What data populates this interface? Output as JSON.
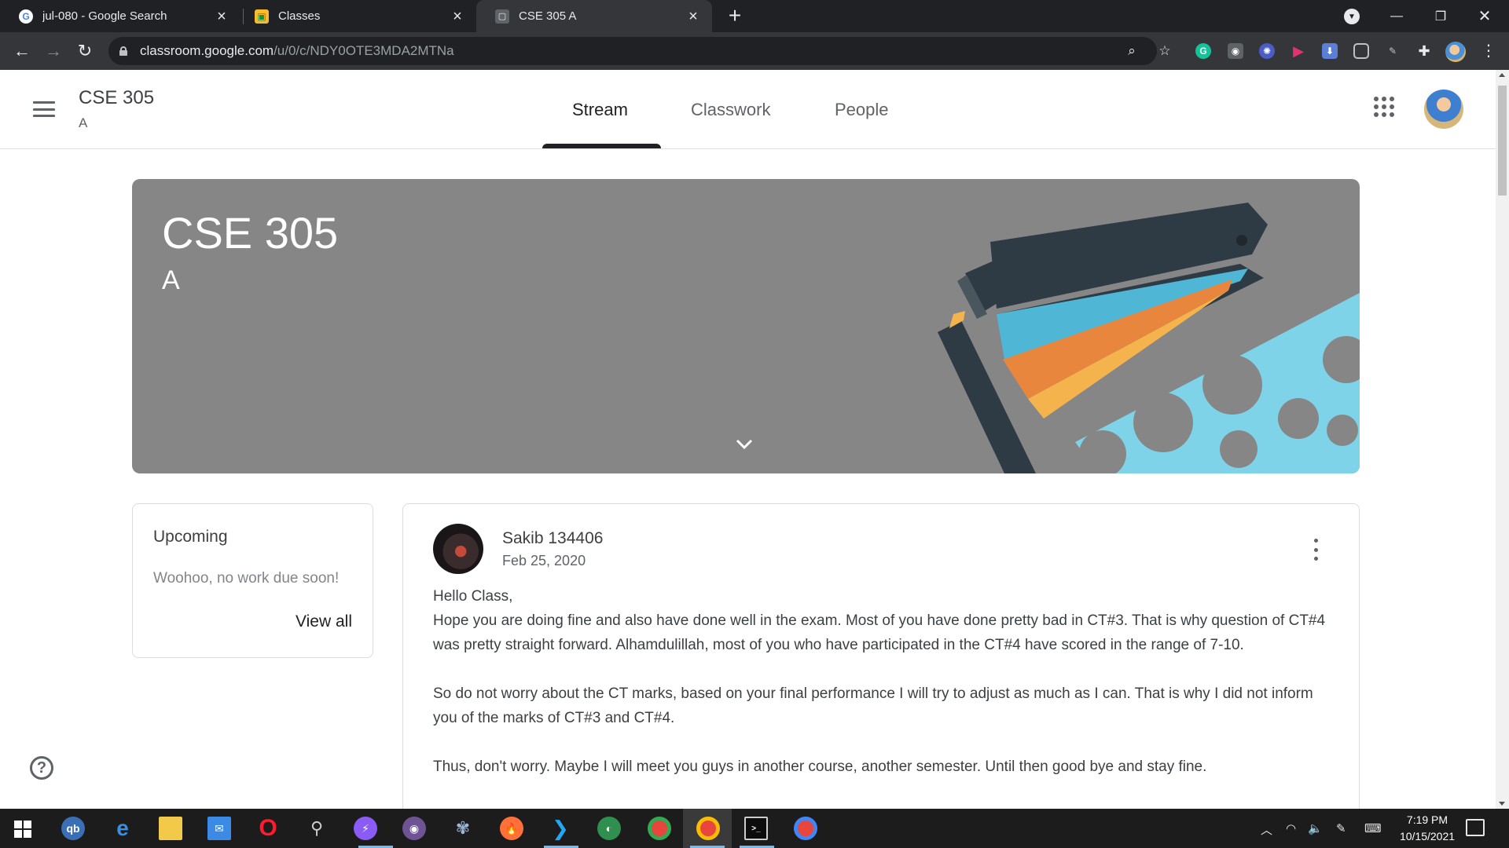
{
  "browser": {
    "tabs": [
      {
        "title": "jul-080 - Google Search",
        "favicon": "google-icon",
        "active": false
      },
      {
        "title": "Classes",
        "favicon": "classroom-icon",
        "active": false
      },
      {
        "title": "CSE 305 A",
        "favicon": "classroom-class-icon",
        "active": true
      }
    ],
    "url_host": "classroom.google.com",
    "url_path": "/u/0/c/NDY0OTE3MDA2MTNa"
  },
  "appbar": {
    "class_name": "CSE 305",
    "section": "A",
    "tabs": [
      {
        "label": "Stream",
        "active": true
      },
      {
        "label": "Classwork",
        "active": false
      },
      {
        "label": "People",
        "active": false
      }
    ]
  },
  "banner": {
    "title": "CSE 305",
    "section": "A",
    "bg_color": "#868686"
  },
  "upcoming": {
    "title": "Upcoming",
    "empty_text": "Woohoo, no work due soon!",
    "view_all": "View all"
  },
  "post": {
    "author": "Sakib 134406",
    "date": "Feb 25, 2020",
    "paragraphs": [
      "Hello Class,",
      "Hope you are doing fine and also have done well in the exam. Most of you have done pretty bad in CT#3. That is why question of CT#4 was pretty straight forward. Alhamdulillah, most of you who have participated in the CT#4 have scored in the range of 7-10.",
      "So do not worry about the CT marks, based on your final performance I will try to adjust as much as I can. That is why I did not inform you of the marks of CT#3 and CT#4.",
      "Thus, don't worry. Maybe I will meet you guys in another course, another semester. Until then good bye and stay fine."
    ]
  },
  "taskbar": {
    "time": "7:19 PM",
    "date": "10/15/2021"
  }
}
